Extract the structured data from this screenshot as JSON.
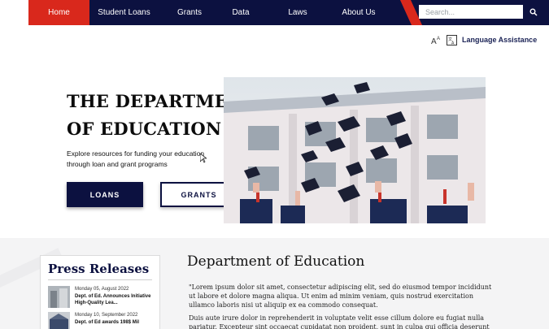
{
  "nav": {
    "items": [
      {
        "label": "Home",
        "active": true
      },
      {
        "label": "Student Loans",
        "active": false
      },
      {
        "label": "Grants",
        "active": false
      },
      {
        "label": "Data",
        "active": false
      },
      {
        "label": "Laws",
        "active": false
      },
      {
        "label": "About Us",
        "active": false
      }
    ],
    "search_placeholder": "Search...",
    "search_icon": "search-icon"
  },
  "language": {
    "label": "Language Assistance",
    "icons": [
      "text-size-icon",
      "translate-icon"
    ]
  },
  "hero": {
    "title_line1": "THE DEPARTMENT",
    "title_line2": "OF EDUCATION",
    "subtitle": "Explore resources for funding your education through loan and grant programs",
    "loans_label": "LOANS",
    "grants_label": "GRANTS",
    "image": "graduation-caps-photo"
  },
  "press": {
    "title": "Press Releases",
    "items": [
      {
        "date": "Monday 05, August 2022",
        "headline": "Dept. of Ed. Announces Initiative High-Quality Lea..."
      },
      {
        "date": "Monday 10, September 2022",
        "headline": "Dept. of Ed awards 198$ Mil"
      }
    ]
  },
  "main": {
    "title": "Department of Education",
    "p1": "\"Lorem ipsum dolor sit amet, consectetur adipiscing elit, sed do eiusmod tempor incididunt ut labore et dolore magna aliqua. Ut enim ad minim veniam, quis nostrud exercitation ullamco laboris nisi ut aliquip ex ea commodo consequat.",
    "p2": "Duis aute irure dolor in reprehenderit in voluptate velit esse cillum dolore eu fugiat nulla pariatur. Excepteur sint occaecat cupidatat non proident, sunt in culpa qui officia deserunt mollit anim id est"
  },
  "colors": {
    "navy": "#0c1140",
    "red": "#d9281c"
  }
}
